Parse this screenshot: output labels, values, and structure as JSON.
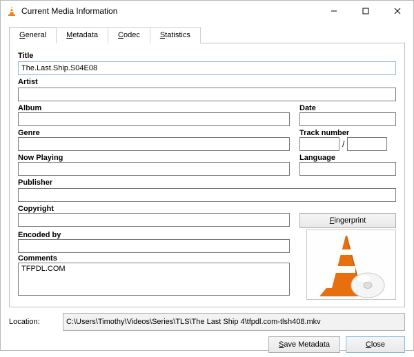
{
  "window": {
    "title": "Current Media Information"
  },
  "tabs": {
    "general": {
      "key": "G",
      "rest": "eneral"
    },
    "metadata": {
      "key": "M",
      "rest": "etadata"
    },
    "codec": {
      "key": "C",
      "rest": "odec"
    },
    "statistics": {
      "key": "S",
      "rest": "tatistics"
    }
  },
  "labels": {
    "title": "Title",
    "artist": "Artist",
    "album": "Album",
    "date": "Date",
    "genre": "Genre",
    "track": "Track number",
    "track_sep": "/",
    "nowplaying": "Now Playing",
    "language": "Language",
    "publisher": "Publisher",
    "copyright": "Copyright",
    "encodedby": "Encoded by",
    "comments": "Comments",
    "location": "Location:"
  },
  "values": {
    "title": "The.Last.Ship.S04E08",
    "artist": "",
    "album": "",
    "date": "",
    "genre": "",
    "track_a": "",
    "track_b": "",
    "nowplaying": "",
    "language": "",
    "publisher": "",
    "copyright": "",
    "encodedby": "",
    "comments": "TFPDL.COM",
    "location": "C:\\Users\\Timothy\\Videos\\Series\\TLS\\The Last Ship 4\\tfpdl.com-tlsh408.mkv"
  },
  "buttons": {
    "fingerprint_key": "F",
    "fingerprint_rest": "ingerprint",
    "save_key": "S",
    "save_rest": "ave Metadata",
    "close_key": "C",
    "close_rest": "lose"
  }
}
